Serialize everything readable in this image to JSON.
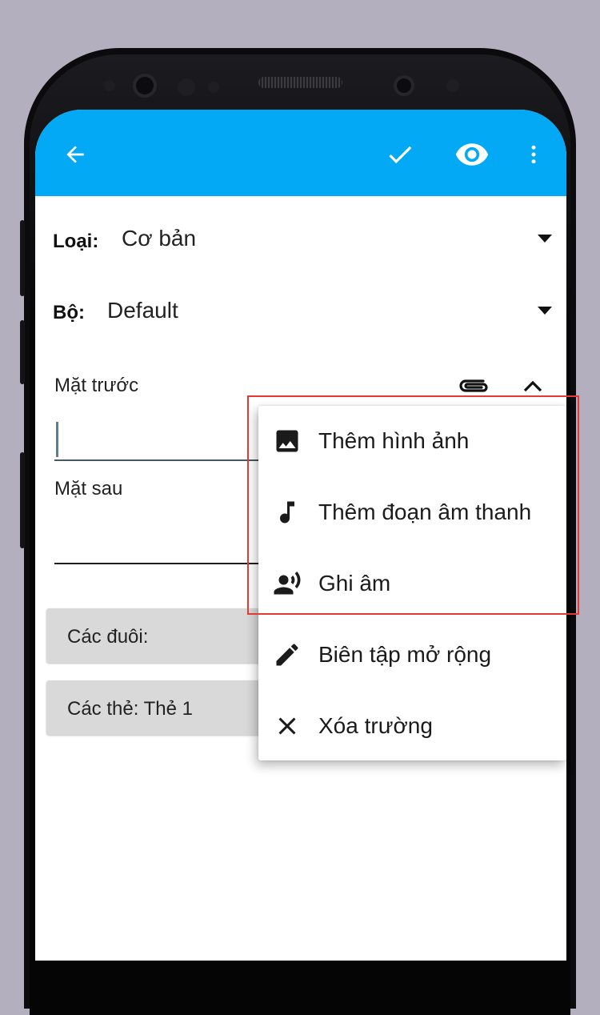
{
  "colors": {
    "toolbar": "#03a9f4",
    "background": "#b4afbf",
    "highlight": "#e53935"
  },
  "toolbar": {
    "back_icon": "arrow-left-icon",
    "confirm_icon": "check-icon",
    "preview_icon": "eye-icon",
    "more_icon": "more-vertical-icon"
  },
  "note_type": {
    "label": "Loại:",
    "value": "Cơ bản"
  },
  "deck": {
    "label": "Bộ:",
    "value": "Default"
  },
  "fields": {
    "front_label": "Mặt trước",
    "back_label": "Mặt sau",
    "front_value": "",
    "back_value": "",
    "attach_icon": "paperclip-icon",
    "collapse_icon": "chevron-up-icon"
  },
  "tags_button": "Các đuôi:",
  "cards_button": "Các thẻ: Thẻ 1",
  "menu": {
    "items": [
      {
        "label": "Thêm hình ảnh",
        "icon": "image-icon"
      },
      {
        "label": "Thêm đoạn âm thanh",
        "icon": "music-note-icon"
      },
      {
        "label": "Ghi âm",
        "icon": "record-voice-icon"
      },
      {
        "label": "Biên tập mở rộng",
        "icon": "pencil-icon"
      },
      {
        "label": "Xóa trường",
        "icon": "close-icon"
      }
    ]
  }
}
